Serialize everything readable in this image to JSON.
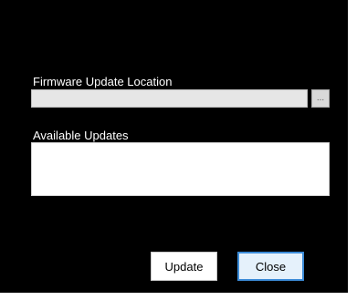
{
  "dialog": {
    "location_label": "Firmware Update Location",
    "location_value": "",
    "browse_label": "...",
    "available_label": "Available Updates",
    "updates": []
  },
  "buttons": {
    "update_label": "Update",
    "close_label": "Close"
  },
  "colors": {
    "dialog_background": "#000000",
    "close_button_focus_border": "#3c8cd8"
  }
}
